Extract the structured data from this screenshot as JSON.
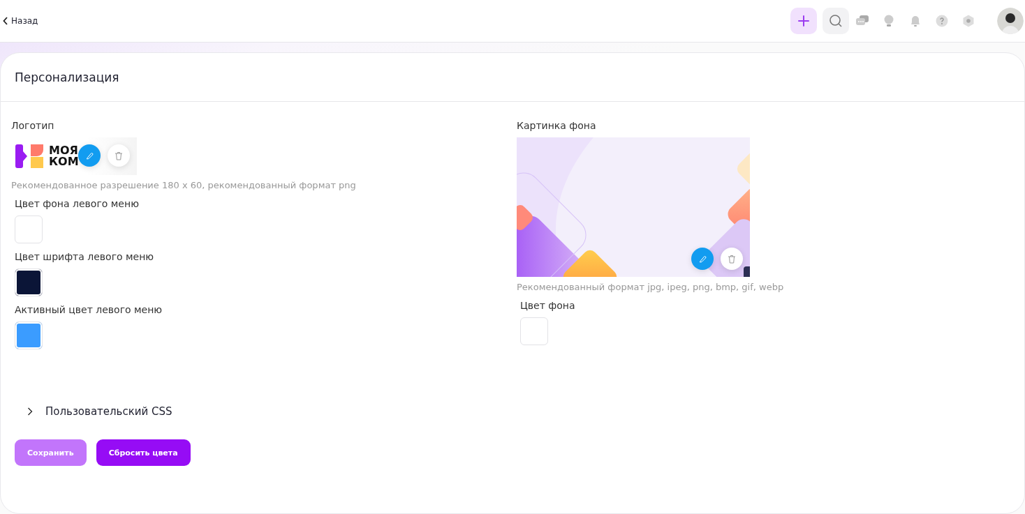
{
  "topbar": {
    "back_label": "Назад"
  },
  "page": {
    "title": "Персонализация"
  },
  "logo": {
    "label": "Логотип",
    "logo_lines": [
      "МОЯ",
      "КОМ"
    ],
    "hint": "Рекомендованное разрешение 180 x 60, рекомендованный формат png"
  },
  "left_colors": [
    {
      "label": "Цвет фона левого меню",
      "color": "#ffffff"
    },
    {
      "label": "Цвет шрифта левого меню",
      "color": "#0b1537"
    },
    {
      "label": "Активный цвет левого меню",
      "color": "#3b9cff"
    }
  ],
  "background": {
    "label": "Картинка фона",
    "hint": "Рекомендованный формат jpg, ipeg, png, bmp, gif, webp",
    "color_label": "Цвет фона",
    "color": "#ffffff"
  },
  "custom_css": {
    "label": "Пользовательский CSS",
    "expanded": false
  },
  "buttons": [
    {
      "label": "Сохранить",
      "disabled": true
    },
    {
      "label": "Сбросить цвета",
      "disabled": false
    }
  ]
}
